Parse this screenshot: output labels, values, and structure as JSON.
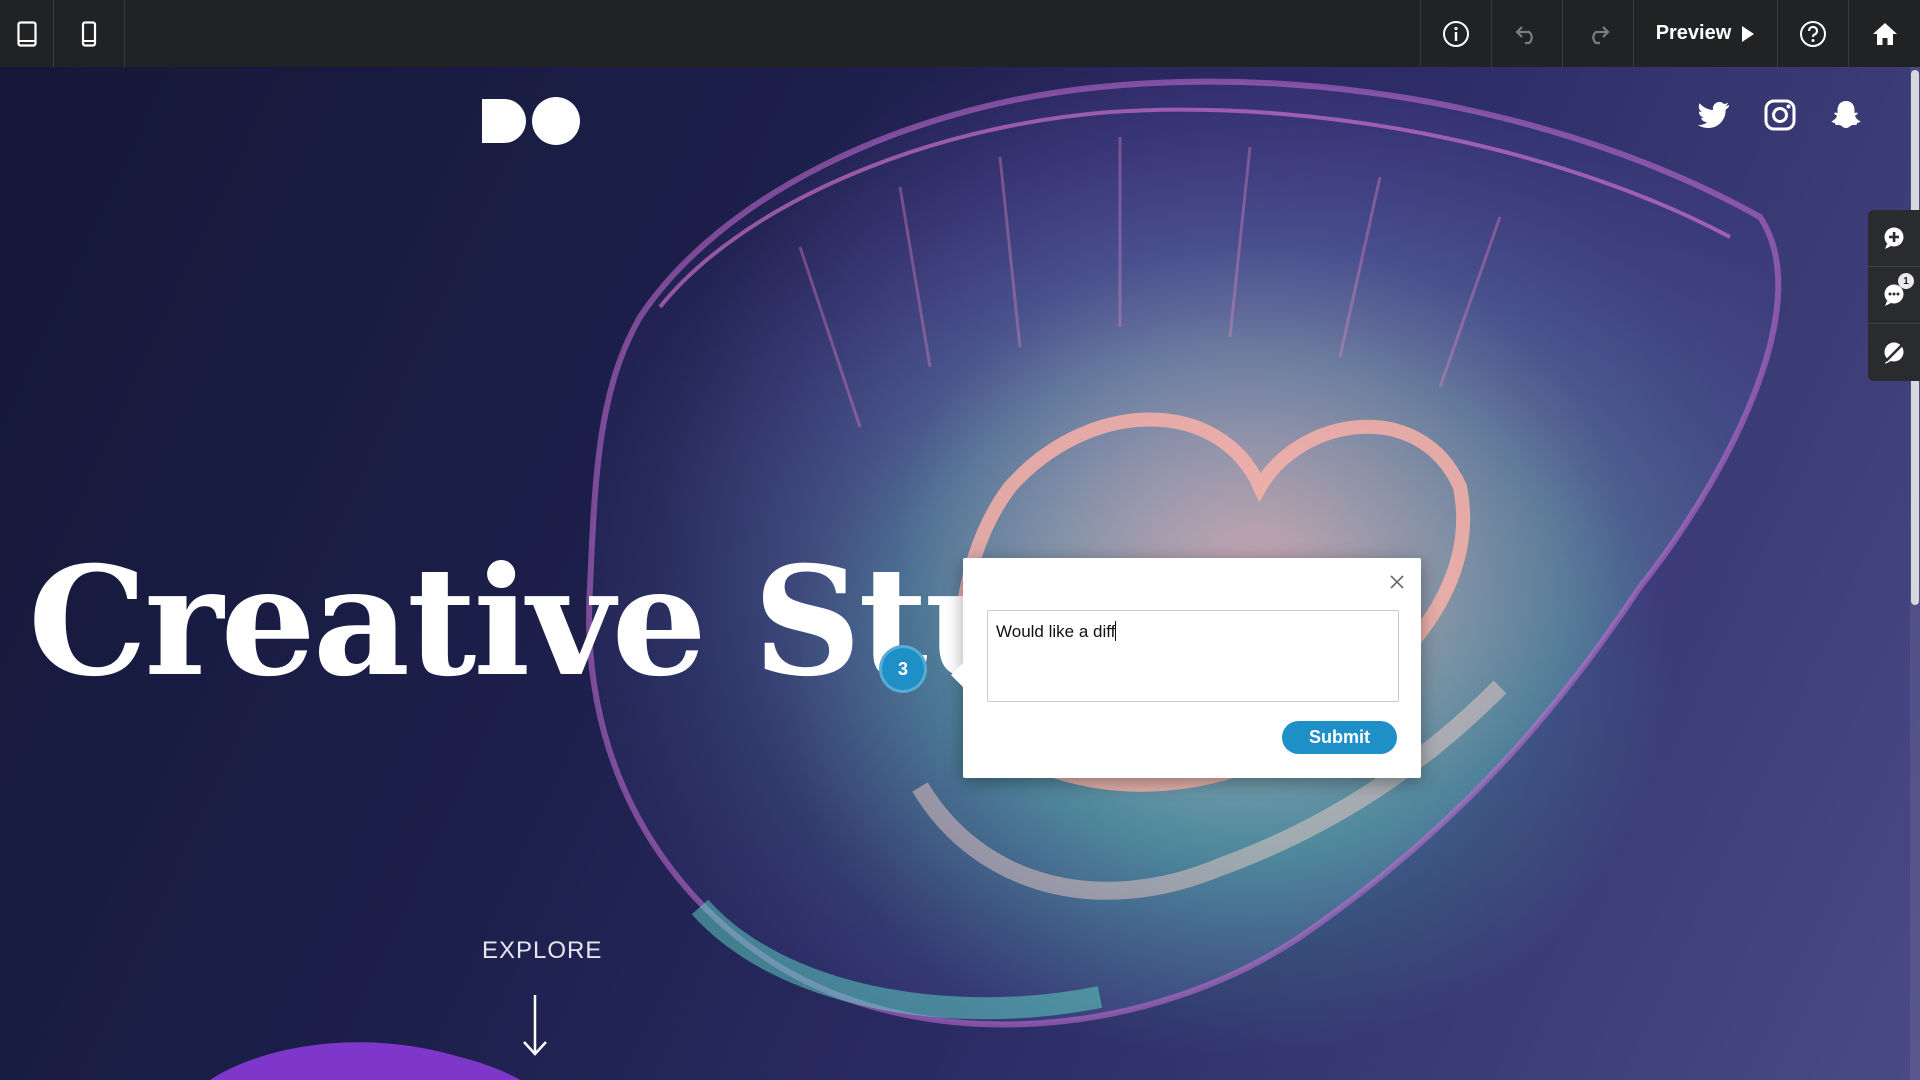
{
  "toolbar": {
    "device_buttons": [
      {
        "icon": "tablet-icon"
      },
      {
        "icon": "mobile-icon"
      }
    ],
    "preview_label": "Preview",
    "icons": {
      "info": "info-icon",
      "undo": "undo-icon",
      "redo": "redo-icon",
      "help": "help-icon",
      "home": "home-icon"
    }
  },
  "hero": {
    "logo_text": "DO",
    "title": "Creative Studio",
    "explore_label": "EXPLORE",
    "social_icons": [
      "twitter-icon",
      "instagram-icon",
      "snapchat-icon"
    ]
  },
  "side_panel": {
    "tabs": [
      {
        "icon": "add-comment-icon"
      },
      {
        "icon": "comments-icon",
        "badge": "1"
      },
      {
        "icon": "hide-comments-icon"
      }
    ]
  },
  "comment": {
    "pin_number": "3",
    "input_value": "Would like a diff",
    "submit_label": "Submit"
  },
  "colors": {
    "toolbar_bg": "#212223",
    "accent_blue": "#1f8fc7",
    "hero_text": "#ffffff"
  }
}
